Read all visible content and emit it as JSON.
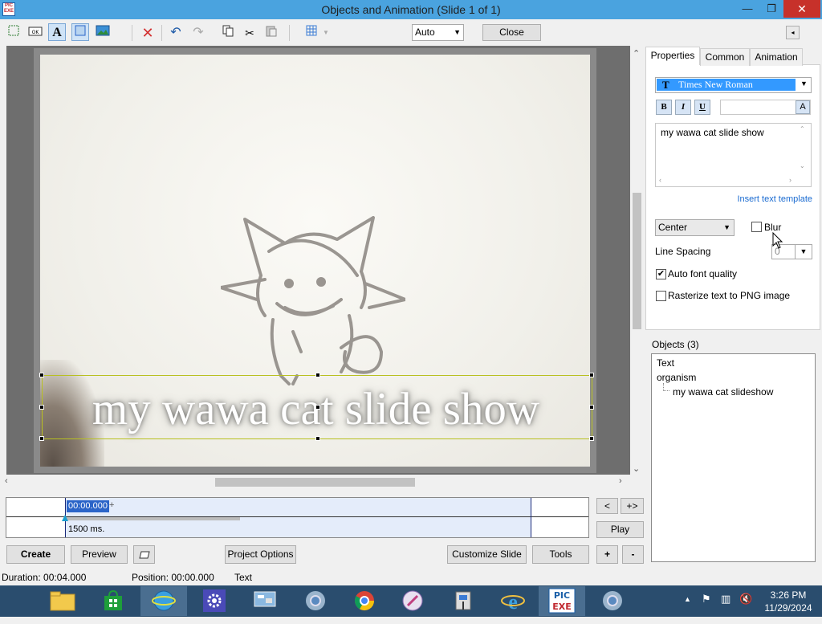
{
  "window": {
    "title": "Objects and Animation  (Slide 1 of 1)",
    "app_icon_text": "PIC EXE",
    "minimize_glyph": "—",
    "restore_glyph": "❐",
    "close_glyph": "✕"
  },
  "toolbar": {
    "zoom_value": "Auto",
    "close_label": "Close",
    "collapse_glyph": "◂"
  },
  "slide": {
    "text": "my wawa cat slide show"
  },
  "timeline": {
    "timecode": "00:00.000",
    "plus": "+",
    "duration": "1500 ms.",
    "prev_label": "<",
    "nav_label": "+>",
    "play_label": "Play"
  },
  "bottom_buttons": {
    "create": "Create",
    "preview": "Preview",
    "project_options": "Project Options",
    "customize_slide": "Customize Slide",
    "tools": "Tools",
    "add": "+",
    "remove": "-"
  },
  "status": {
    "duration": "Duration:  00:04.000",
    "position": "Position:  00:00.000",
    "object": "Text"
  },
  "panel": {
    "tabs": [
      "Properties",
      "Common",
      "Animation"
    ],
    "font_name": "Times New Roman",
    "bold": "B",
    "italic": "I",
    "underline": "U",
    "color_btn": "A",
    "text_value": "my wawa cat slide show",
    "insert_template": "Insert text template",
    "align_value": "Center",
    "blur_label": "Blur",
    "line_spacing_label": "Line Spacing",
    "line_spacing_value": "0",
    "auto_font_label": "Auto font quality",
    "auto_font_checked": true,
    "rasterize_label": "Rasterize text to PNG image",
    "rasterize_checked": false,
    "blur_checked": false
  },
  "objects": {
    "label": "Objects (3)",
    "items": [
      "Text",
      "organism",
      "my wawa cat slideshow"
    ]
  },
  "taskbar": {
    "time": "3:26 PM",
    "date": "11/29/2024"
  }
}
